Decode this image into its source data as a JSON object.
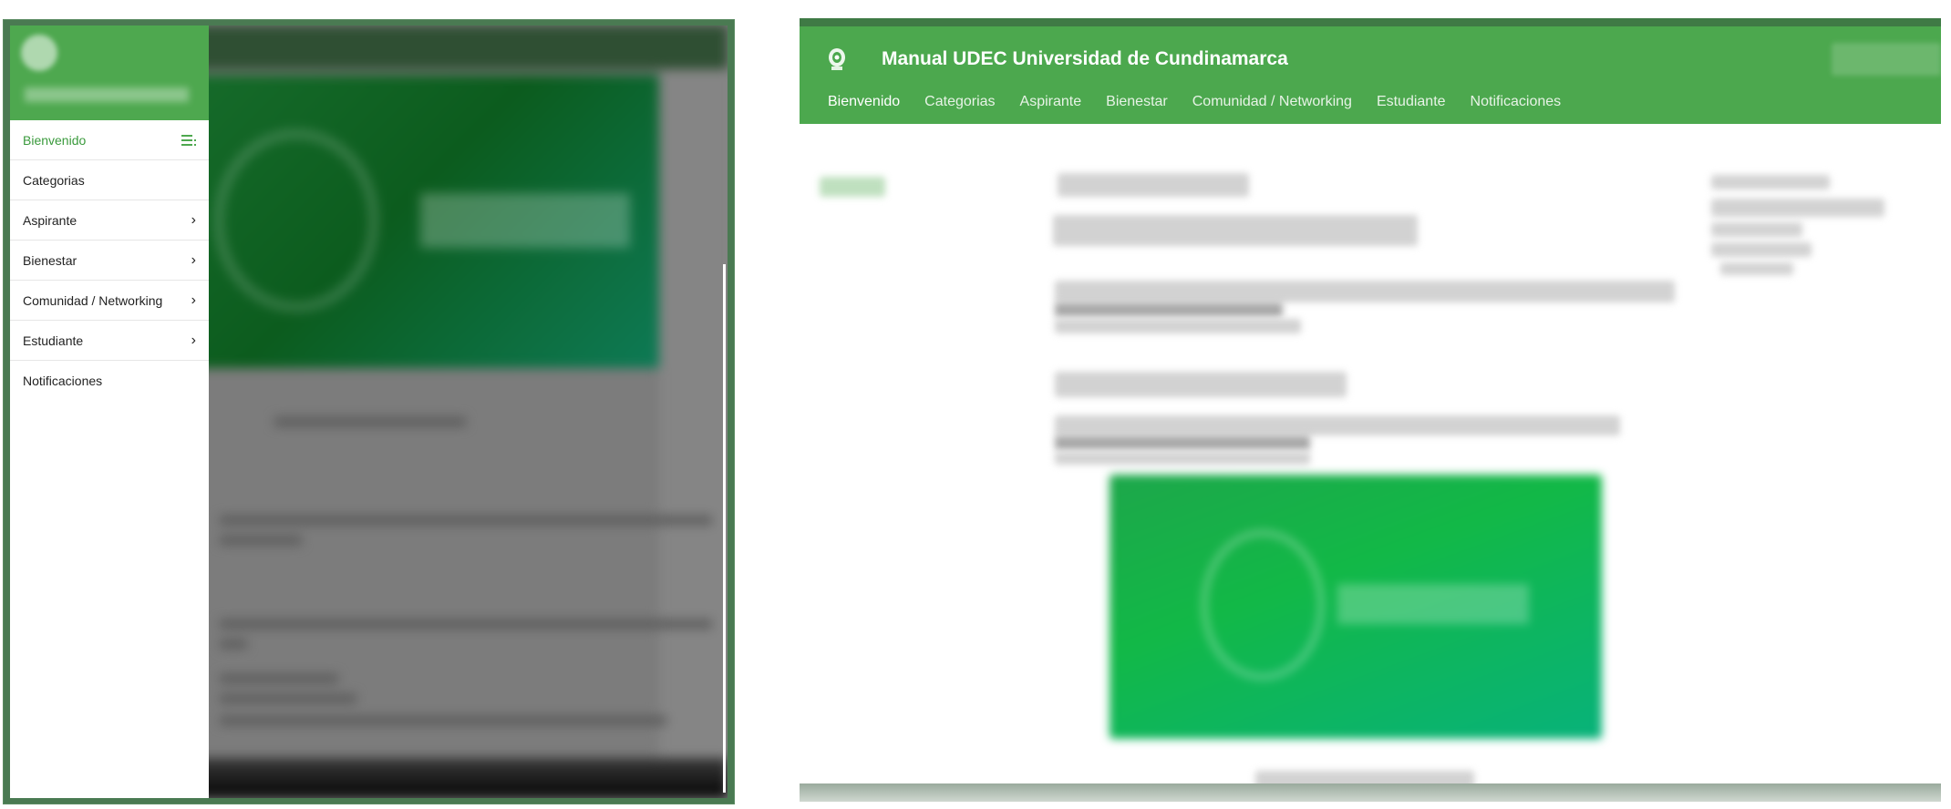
{
  "mobile": {
    "drawer": {
      "items": [
        {
          "label": "Bienvenido",
          "active": true,
          "icon": "menu-lines-icon"
        },
        {
          "label": "Categorias",
          "active": false,
          "icon": ""
        },
        {
          "label": "Aspirante",
          "active": false,
          "icon": "chevron-right-icon"
        },
        {
          "label": "Bienestar",
          "active": false,
          "icon": "chevron-right-icon"
        },
        {
          "label": "Comunidad / Networking",
          "active": false,
          "icon": "chevron-right-icon"
        },
        {
          "label": "Estudiante",
          "active": false,
          "icon": "chevron-right-icon"
        },
        {
          "label": "Notificaciones",
          "active": false,
          "icon": ""
        }
      ]
    }
  },
  "desktop": {
    "title": "Manual UDEC Universidad de Cundinamarca",
    "nav": [
      {
        "label": "Bienvenido",
        "active": true
      },
      {
        "label": "Categorias",
        "active": false
      },
      {
        "label": "Aspirante",
        "active": false
      },
      {
        "label": "Bienestar",
        "active": false
      },
      {
        "label": "Comunidad / Networking",
        "active": false
      },
      {
        "label": "Estudiante",
        "active": false
      },
      {
        "label": "Notificaciones",
        "active": false
      }
    ]
  },
  "colors": {
    "brand_green": "#4ca84e",
    "active_link": "#3a9a3c",
    "overlay_gray": "#7c7c7c"
  }
}
